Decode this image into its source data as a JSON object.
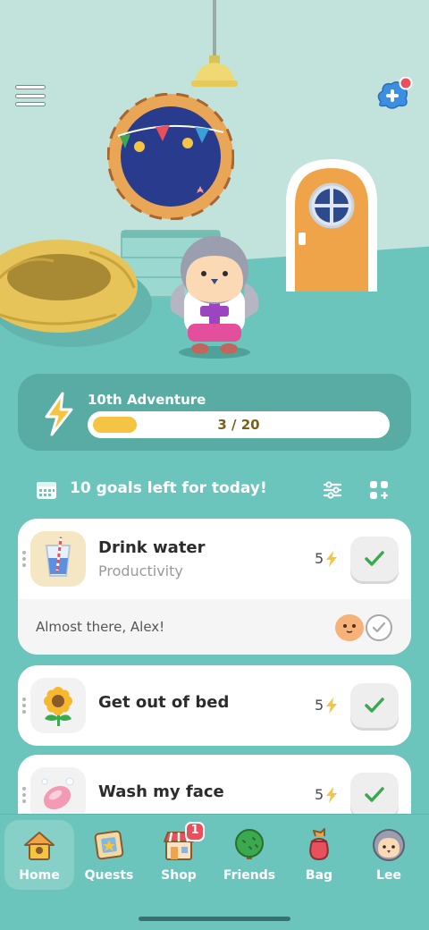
{
  "adventure": {
    "title": "10th Adventure",
    "progress_text": "3 / 20",
    "progress_value": 3,
    "progress_total": 20
  },
  "goals_header": {
    "title": "10 goals left for today!"
  },
  "goals": [
    {
      "name": "Drink water",
      "category": "Productivity",
      "points": "5",
      "icon": "water-glass-icon",
      "footer": "Almost there, Alex!"
    },
    {
      "name": "Get out of bed",
      "category": "",
      "points": "5",
      "icon": "sunflower-icon"
    },
    {
      "name": "Wash my face",
      "category": "",
      "points": "5",
      "icon": "soap-icon"
    }
  ],
  "nav": {
    "items": [
      {
        "label": "Home",
        "icon": "house-icon",
        "active": true
      },
      {
        "label": "Quests",
        "icon": "quest-map-icon",
        "active": false
      },
      {
        "label": "Shop",
        "icon": "shop-icon",
        "active": false,
        "badge": "1"
      },
      {
        "label": "Friends",
        "icon": "tree-icon",
        "active": false
      },
      {
        "label": "Bag",
        "icon": "bag-icon",
        "active": false
      },
      {
        "label": "Lee",
        "icon": "profile-avatar-icon",
        "active": false
      }
    ]
  },
  "colors": {
    "background": "#6cc5bc",
    "wall": "#c2e2dc",
    "accent_yellow": "#f5c443",
    "check_green": "#3aa94f",
    "notification_red": "#e8505b"
  }
}
